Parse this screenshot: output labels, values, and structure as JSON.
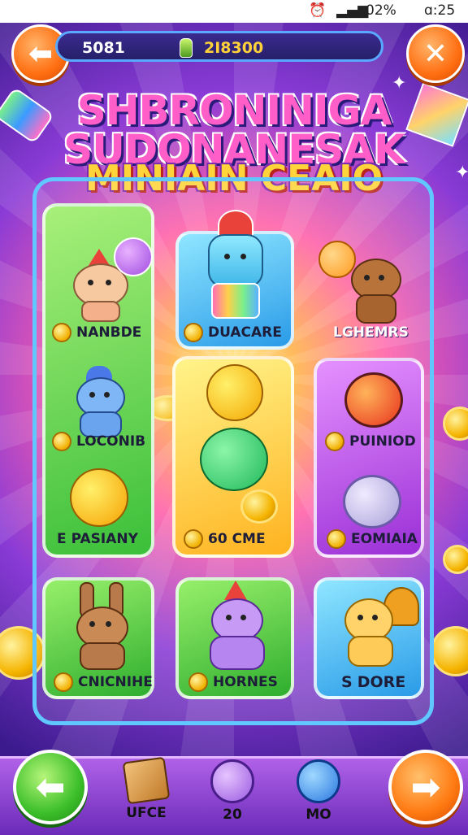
{
  "status_bar": {
    "battery": "02%",
    "time": "ɑ:25"
  },
  "top_bar": {
    "coins": "5081",
    "gems": "2I8300"
  },
  "title": {
    "line1": "SHBRONINIGA",
    "line2": "SUDONANESAK",
    "line3": "MINIAIN CEAIO"
  },
  "cards": [
    {
      "label": "NANBDE",
      "character": "bear-party-hat"
    },
    {
      "label": "DUACARE",
      "character": "rocket-robot"
    },
    {
      "label": "LGHEMRS",
      "character": "brown-bear"
    },
    {
      "label": "LOCONIB",
      "character": "blue-bear"
    },
    {
      "label": "60 CME",
      "character": "stacked-smileys"
    },
    {
      "label": "PUINIOD",
      "character": "ladybug-toy"
    },
    {
      "label": "PASIANY",
      "character": "smiley-ball",
      "badge": "E"
    },
    {
      "label": "EOMIAIA",
      "character": "purple-coin"
    },
    {
      "label": "CNICNIHE",
      "character": "bunny"
    },
    {
      "label": "HORNES",
      "character": "purple-bear"
    },
    {
      "label": "DORE",
      "character": "yellow-dog",
      "badge": "S"
    }
  ],
  "bottom_nav": [
    {
      "label": "UFCE",
      "icon": "box-icon"
    },
    {
      "label": "20",
      "icon": "button-icon"
    },
    {
      "label": "MO",
      "icon": "puzzle-icon"
    }
  ],
  "colors": {
    "accent_orange": "#ff6f12",
    "accent_green": "#3cbf2a",
    "frame_blue": "#60c7ff",
    "bar_purple": "#8a3bd6"
  }
}
